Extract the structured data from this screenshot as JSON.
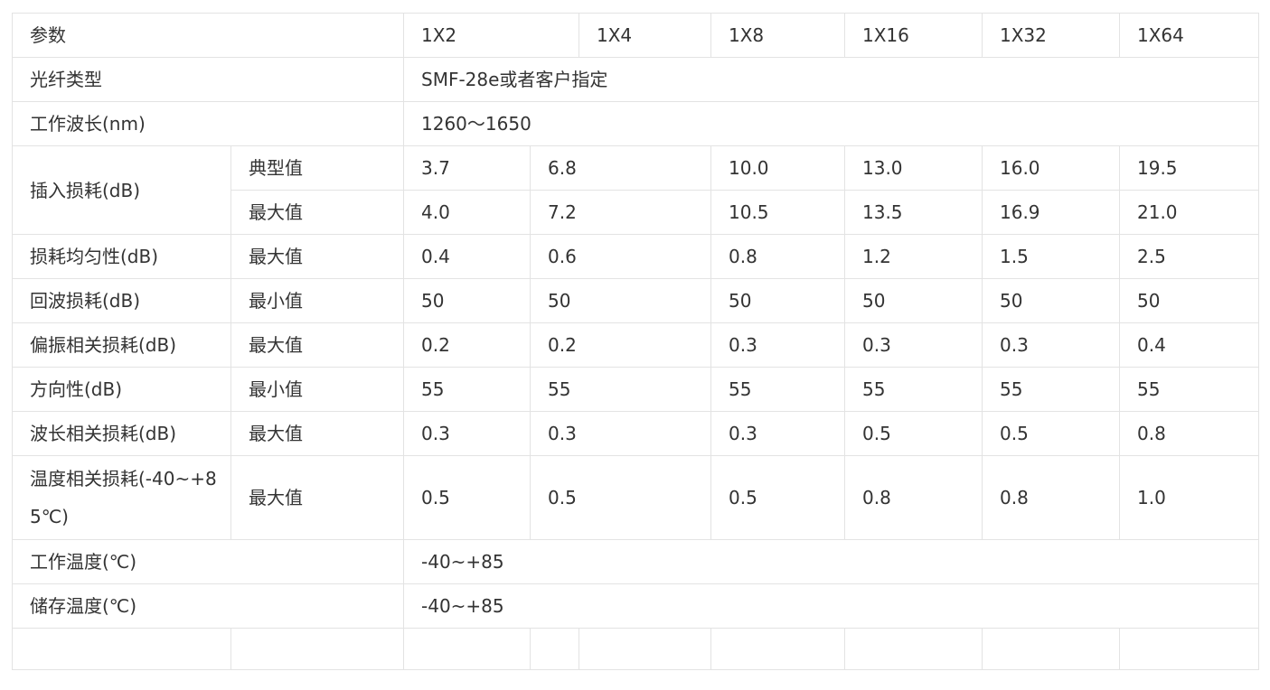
{
  "header": {
    "param": "参数",
    "models": [
      "1X2",
      "1X4",
      "1X8",
      "1X16",
      "1X32",
      "1X64"
    ]
  },
  "fiber_type": {
    "label": "光纤类型",
    "value": "SMF-28e或者客户指定"
  },
  "wavelength": {
    "label": "工作波长(nm)",
    "value": "1260～1650"
  },
  "insertion_loss": {
    "label": "插入损耗(dB)",
    "typical_label": "典型值",
    "typical": [
      "3.7",
      "6.8",
      "10.0",
      "13.0",
      "16.0",
      "19.5"
    ],
    "max_label": "最大值",
    "max": [
      "4.0",
      "7.2",
      "10.5",
      "13.5",
      "16.9",
      "21.0"
    ]
  },
  "rows": [
    {
      "label": "损耗均匀性(dB)",
      "sub": "最大值",
      "values": [
        "0.4",
        "0.6",
        "0.8",
        "1.2",
        "1.5",
        "2.5"
      ]
    },
    {
      "label": "回波损耗(dB)",
      "sub": "最小值",
      "values": [
        "50",
        "50",
        "50",
        "50",
        "50",
        "50"
      ]
    },
    {
      "label": "偏振相关损耗(dB)",
      "sub": "最大值",
      "values": [
        "0.2",
        "0.2",
        "0.3",
        "0.3",
        "0.3",
        "0.4"
      ]
    },
    {
      "label": "方向性(dB)",
      "sub": "最小值",
      "values": [
        "55",
        "55",
        "55",
        "55",
        "55",
        "55"
      ]
    },
    {
      "label": "波长相关损耗(dB)",
      "sub": "最大值",
      "values": [
        "0.3",
        "0.3",
        "0.3",
        "0.5",
        "0.5",
        "0.8"
      ]
    },
    {
      "label": "温度相关损耗(-40~+85℃)",
      "sub": "最大值",
      "values": [
        "0.5",
        "0.5",
        "0.5",
        "0.8",
        "0.8",
        "1.0"
      ]
    }
  ],
  "operating_temp": {
    "label": "工作温度(℃)",
    "value": "-40~+85"
  },
  "storage_temp": {
    "label": "储存温度(℃)",
    "value": "-40~+85"
  }
}
